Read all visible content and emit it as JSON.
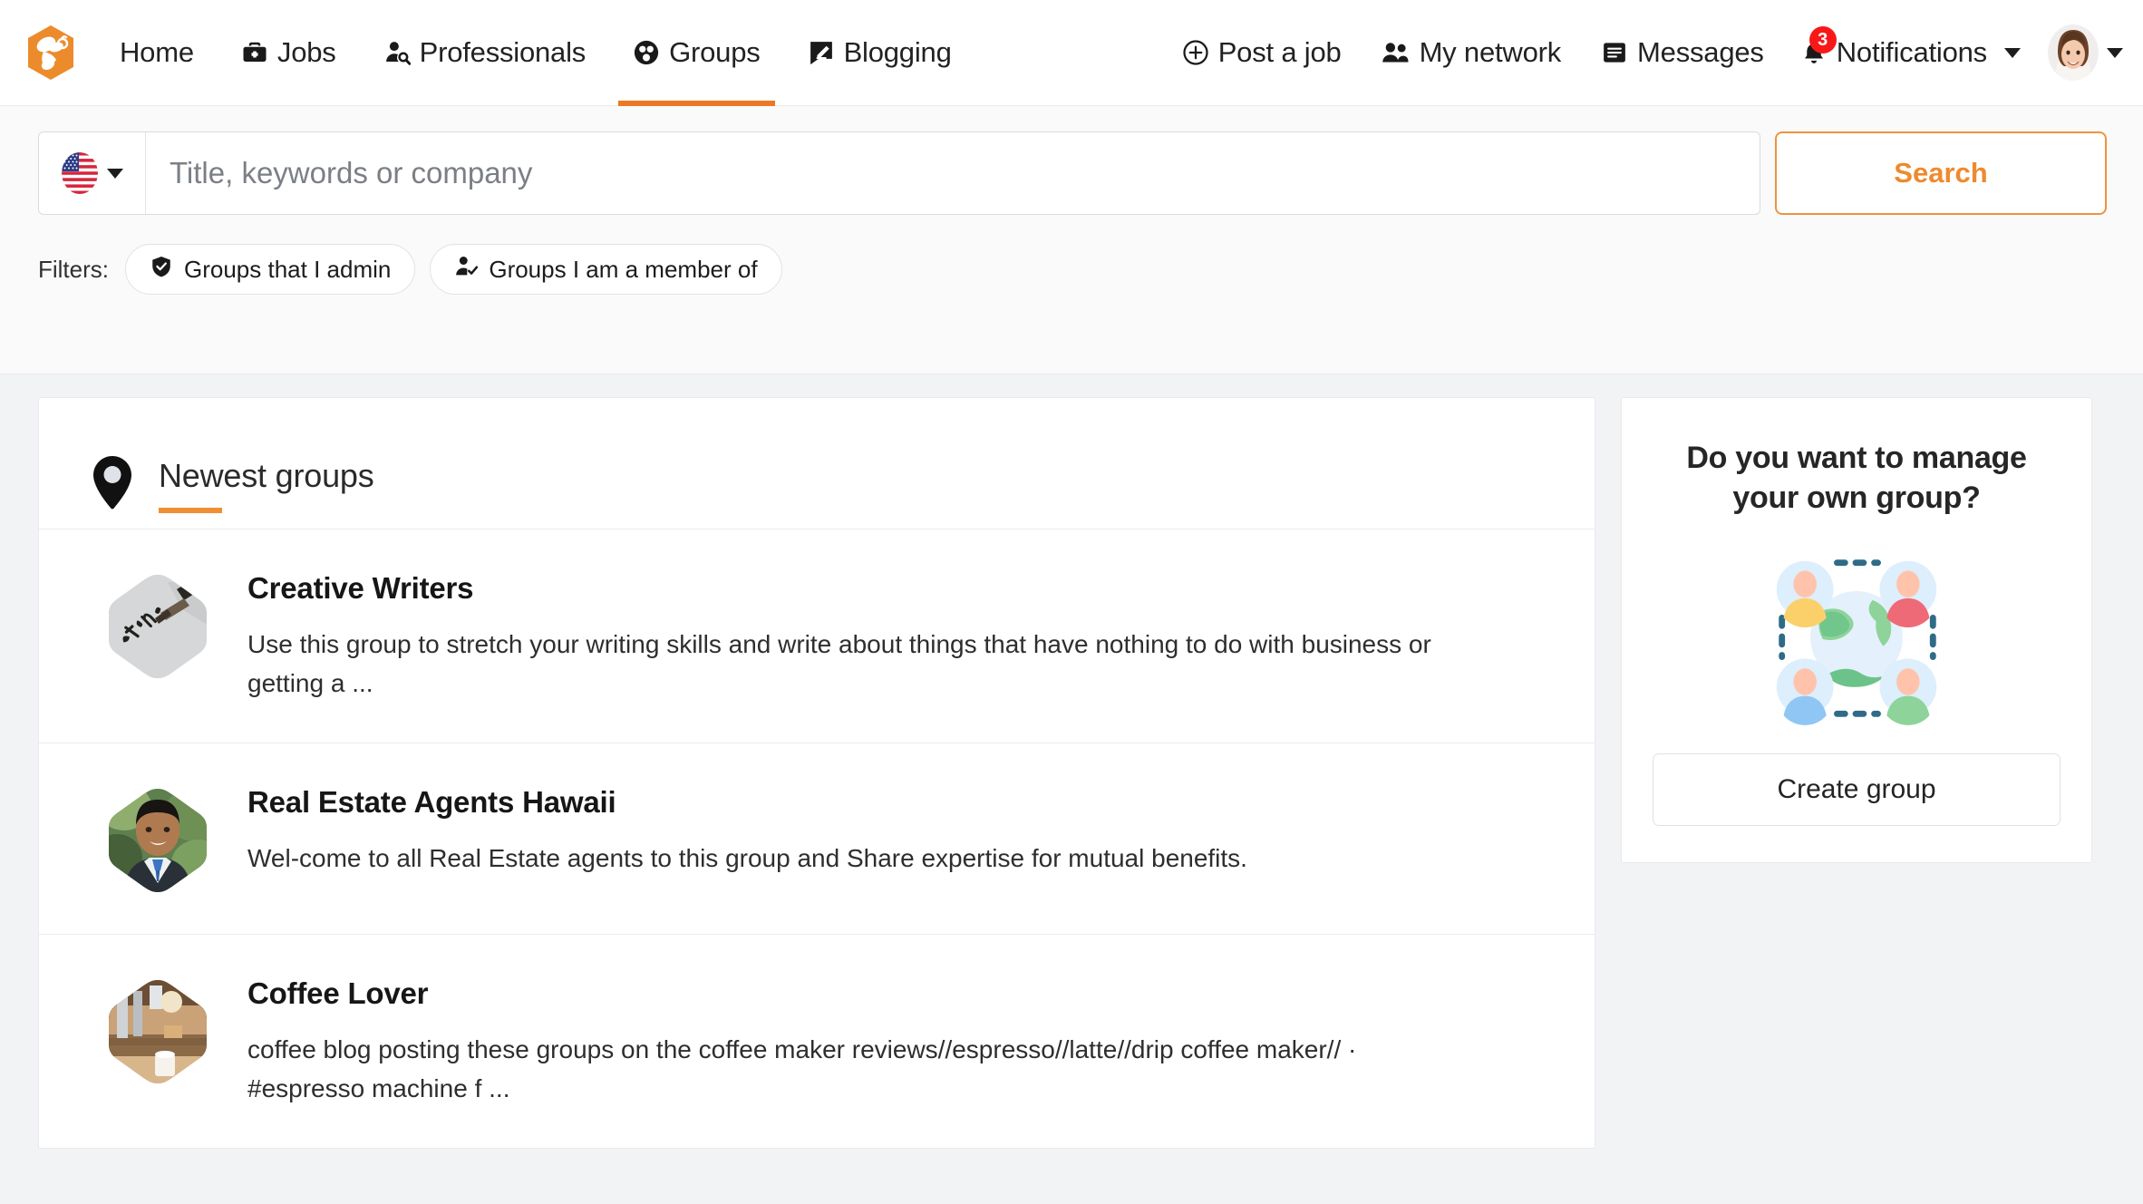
{
  "brand": {
    "logo_icon": "bee-hexagon-logo",
    "accent_color": "#ec7825",
    "badge_color": "#f91818"
  },
  "nav": {
    "left_items": [
      {
        "label": "Home",
        "icon": "",
        "active": false
      },
      {
        "label": "Jobs",
        "icon": "briefcase-icon",
        "active": false
      },
      {
        "label": "Professionals",
        "icon": "person-search-icon",
        "active": false
      },
      {
        "label": "Groups",
        "icon": "groups-icon",
        "active": true
      },
      {
        "label": "Blogging",
        "icon": "blog-pencil-icon",
        "active": false
      }
    ],
    "right_items": [
      {
        "label": "Post a job",
        "icon": "plus-circle-icon"
      },
      {
        "label": "My network",
        "icon": "people-icon"
      },
      {
        "label": "Messages",
        "icon": "message-icon"
      },
      {
        "label": "Notifications",
        "icon": "bell-icon",
        "badge": "3"
      }
    ],
    "profile": {
      "icon": "user-avatar",
      "menu_icon": "chevron-down-icon"
    }
  },
  "search": {
    "country_flag": "us-flag-icon",
    "country_caret": "chevron-down-icon",
    "placeholder": "Title, keywords or company",
    "value": "",
    "button_label": "Search",
    "filters_label": "Filters:",
    "filters": [
      {
        "label": "Groups that I admin",
        "icon": "shield-check-icon"
      },
      {
        "label": "Groups I am a member of",
        "icon": "person-check-icon"
      }
    ]
  },
  "main": {
    "section_icon": "map-pin-icon",
    "section_title": "Newest groups",
    "groups": [
      {
        "name": "Creative Writers",
        "description": "Use this group to stretch your writing skills and write about things that have nothing to do with business or getting a ...",
        "avatar": "handwriting-notebook-photo"
      },
      {
        "name": "Real Estate Agents Hawaii",
        "description": "Wel-come to all Real Estate agents to this group and Share expertise for mutual benefits.",
        "avatar": "man-in-suit-photo"
      },
      {
        "name": "Coffee Lover",
        "description": "coffee blog posting these groups on the coffee maker reviews//espresso//latte//drip coffee maker// · #espresso machine f ...",
        "avatar": "espresso-machine-photo"
      }
    ]
  },
  "sidebar": {
    "title": "Do you want to manage your own group?",
    "illustration": "people-around-globe-illustration",
    "create_button_label": "Create group"
  }
}
